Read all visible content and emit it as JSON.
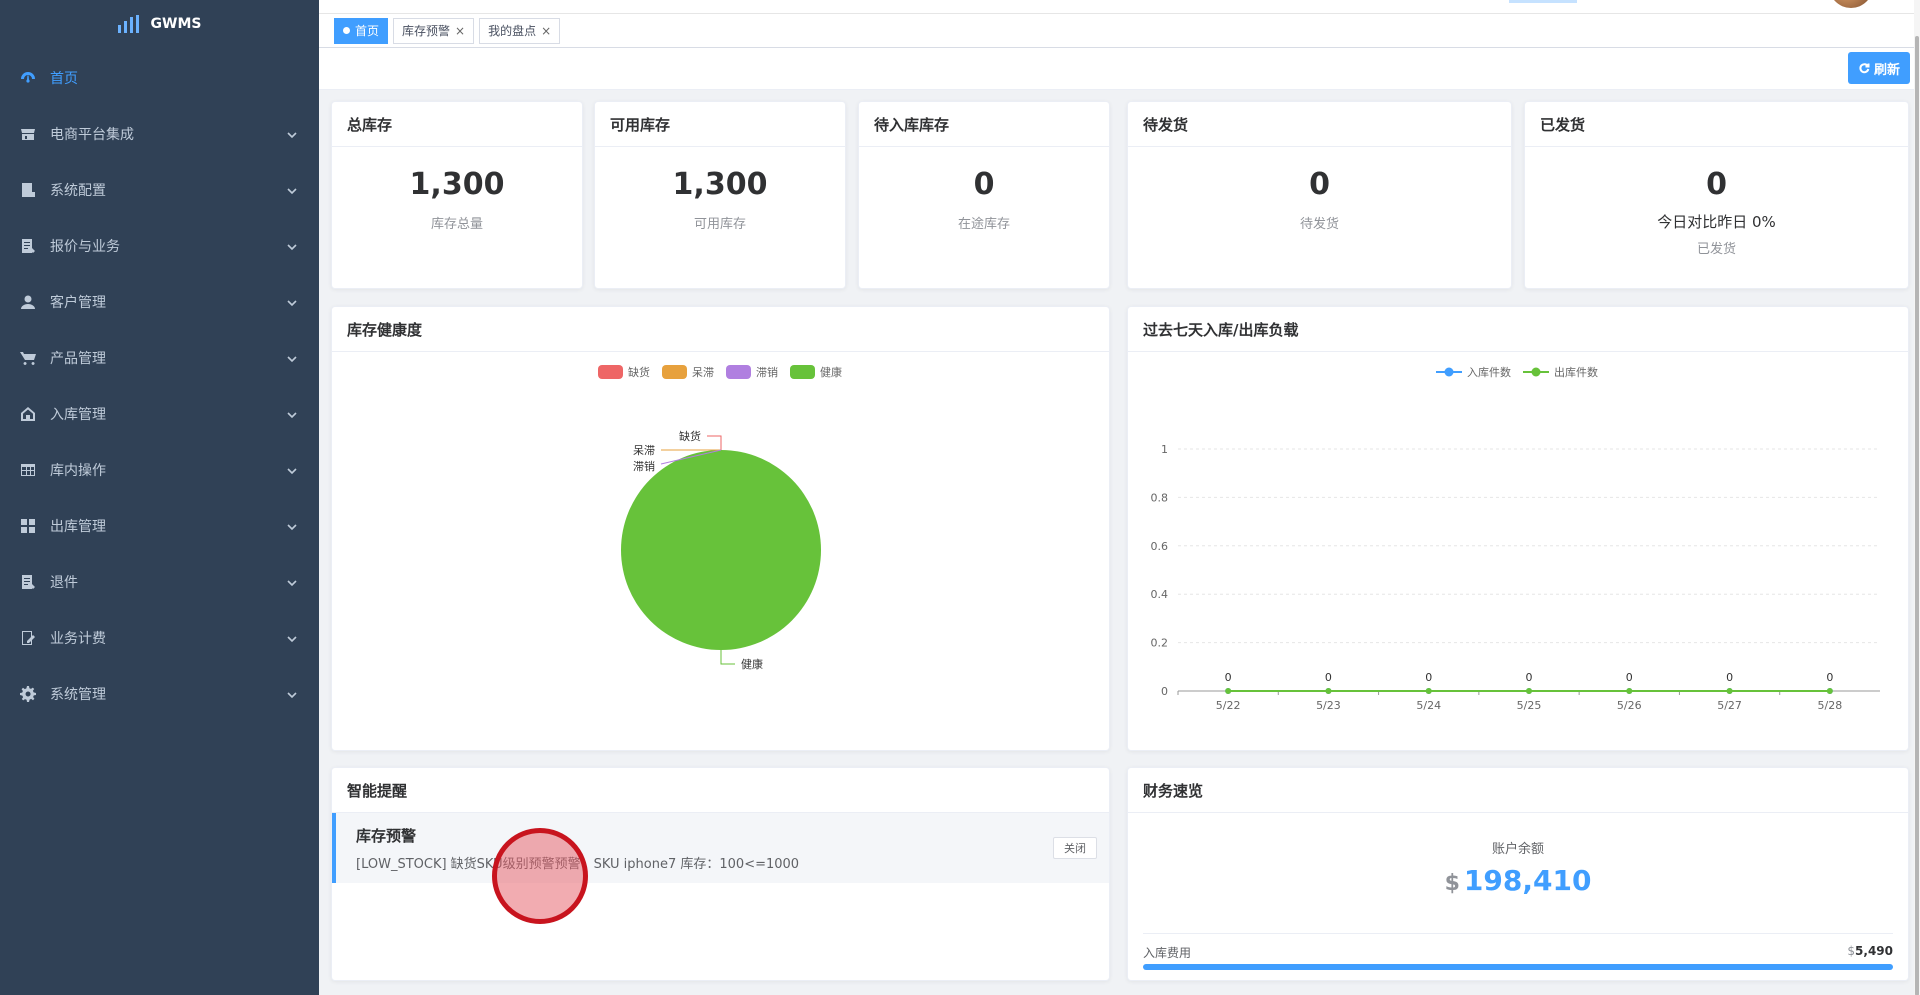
{
  "sidebar": {
    "brand": "GWMS",
    "items": [
      {
        "label": "首页",
        "icon": "dashboard-icon"
      },
      {
        "label": "电商平台集成",
        "icon": "shop-icon"
      },
      {
        "label": "系统配置",
        "icon": "config-icon"
      },
      {
        "label": "报价与业务",
        "icon": "quote-icon"
      },
      {
        "label": "客户管理",
        "icon": "user-icon"
      },
      {
        "label": "产品管理",
        "icon": "cart-icon"
      },
      {
        "label": "入库管理",
        "icon": "home-icon"
      },
      {
        "label": "库内操作",
        "icon": "grid-table-icon"
      },
      {
        "label": "出库管理",
        "icon": "apps-icon"
      },
      {
        "label": "退件",
        "icon": "return-icon"
      },
      {
        "label": "业务计费",
        "icon": "edit-doc-icon"
      },
      {
        "label": "系统管理",
        "icon": "gear-icon"
      }
    ]
  },
  "tags": [
    {
      "label": "首页",
      "active": true
    },
    {
      "label": "库存预警",
      "closable": "×"
    },
    {
      "label": "我的盘点",
      "closable": "×"
    }
  ],
  "toolbar": {
    "refresh_label": "刷新"
  },
  "stats": [
    {
      "title": "总库存",
      "value": "1,300",
      "sub": "库存总量"
    },
    {
      "title": "可用库存",
      "value": "1,300",
      "sub": "可用库存"
    },
    {
      "title": "待入库库存",
      "value": "0",
      "sub": "在途库存"
    },
    {
      "title": "待发货",
      "value": "0",
      "sub": "待发货"
    },
    {
      "title": "已发货",
      "value": "0",
      "compare": "今日对比昨日 0%",
      "sub": "已发货"
    }
  ],
  "health": {
    "title": "库存健康度",
    "legend": [
      {
        "name": "缺货",
        "color": "#ee6666"
      },
      {
        "name": "呆滞",
        "color": "#e7a13d"
      },
      {
        "name": "滞销",
        "color": "#b07fe0"
      },
      {
        "name": "健康",
        "color": "#67c23a"
      }
    ]
  },
  "load": {
    "title": "过去七天入库/出库负载",
    "legend": [
      {
        "name": "入库件数",
        "color": "#409eff"
      },
      {
        "name": "出库件数",
        "color": "#67c23a"
      }
    ]
  },
  "chart_data": [
    {
      "type": "pie",
      "title": "库存健康度",
      "labels": [
        "缺货",
        "呆滞",
        "滞销",
        "健康"
      ],
      "values": [
        0,
        0,
        0,
        1300
      ],
      "colors": [
        "#ee6666",
        "#e7a13d",
        "#b07fe0",
        "#67c23a"
      ],
      "legend_position": "top"
    },
    {
      "type": "line",
      "title": "过去七天入库/出库负载",
      "x": [
        "5/22",
        "5/23",
        "5/24",
        "5/25",
        "5/26",
        "5/27",
        "5/28"
      ],
      "series": [
        {
          "name": "入库件数",
          "values": [
            0,
            0,
            0,
            0,
            0,
            0,
            0
          ],
          "color": "#409eff"
        },
        {
          "name": "出库件数",
          "values": [
            0,
            0,
            0,
            0,
            0,
            0,
            0
          ],
          "color": "#67c23a"
        }
      ],
      "ylim": [
        0,
        1
      ],
      "yticks": [
        "0",
        "0.2",
        "0.4",
        "0.6",
        "0.8",
        "1"
      ],
      "data_labels": [
        "0",
        "0",
        "0",
        "0",
        "0",
        "0",
        "0"
      ],
      "grid": true,
      "legend_position": "top"
    }
  ],
  "alerts": {
    "title": "智能提醒",
    "items": [
      {
        "title": "库存预警",
        "message": "[LOW_STOCK] 缺货SKU级别预警预警：SKU iphone7 库存：100<=1000",
        "close_label": "关闭"
      }
    ]
  },
  "finance": {
    "title": "财务速览",
    "balance_label": "账户余额",
    "currency": "$",
    "balance": "198,410",
    "inbound_fee_label": "入库费用",
    "inbound_fee": "5,490"
  }
}
